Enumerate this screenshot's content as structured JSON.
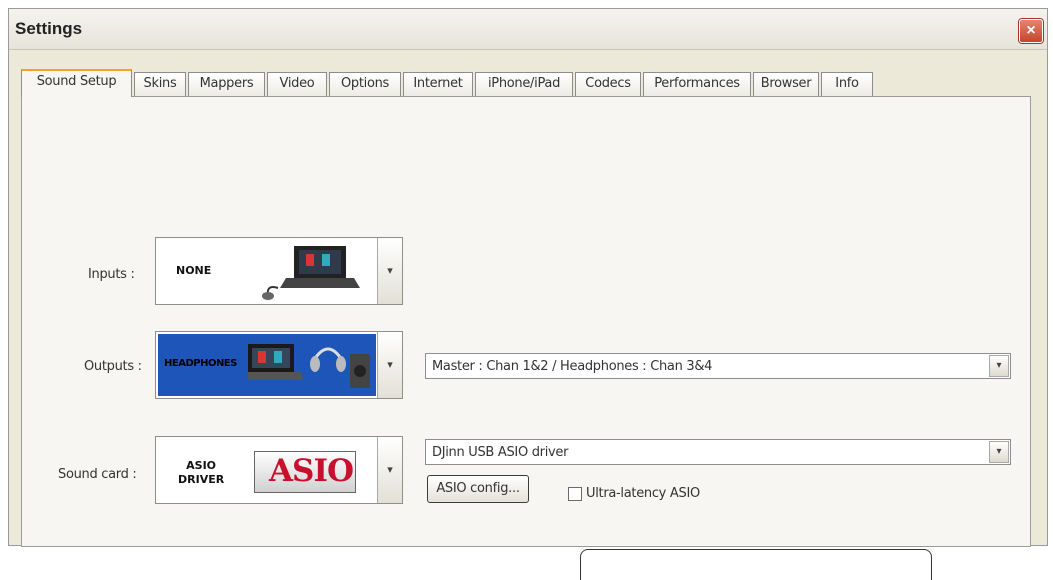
{
  "window": {
    "title": "Settings",
    "close_label": "×"
  },
  "tabs": [
    {
      "label": "Sound Setup",
      "active": true
    },
    {
      "label": "Skins"
    },
    {
      "label": "Mappers"
    },
    {
      "label": "Video"
    },
    {
      "label": "Options"
    },
    {
      "label": "Internet"
    },
    {
      "label": "iPhone/iPad"
    },
    {
      "label": "Codecs"
    },
    {
      "label": "Performances"
    },
    {
      "label": "Browser"
    },
    {
      "label": "Info"
    }
  ],
  "inputs": {
    "label": "Inputs :",
    "device_text": "NONE"
  },
  "outputs": {
    "label": "Outputs :",
    "device_text": "HEADPHONES",
    "routing_value": "Master : Chan 1&2 / Headphones : Chan 3&4"
  },
  "sound_card": {
    "label": "Sound card :",
    "device_text_line1": "ASIO",
    "device_text_line2": "DRIVER",
    "logo_text": "ASIO",
    "driver_value": "DJinn USB ASIO driver",
    "config_button": "ASIO config...",
    "ultra_latency_label": "Ultra-latency ASIO",
    "ultra_latency_checked": false
  },
  "icons": {
    "dropdown": "▾"
  },
  "colors": {
    "accent": "#f0a22a",
    "output_device_bg": "#1d56b8",
    "close_button": "#c8442a"
  }
}
